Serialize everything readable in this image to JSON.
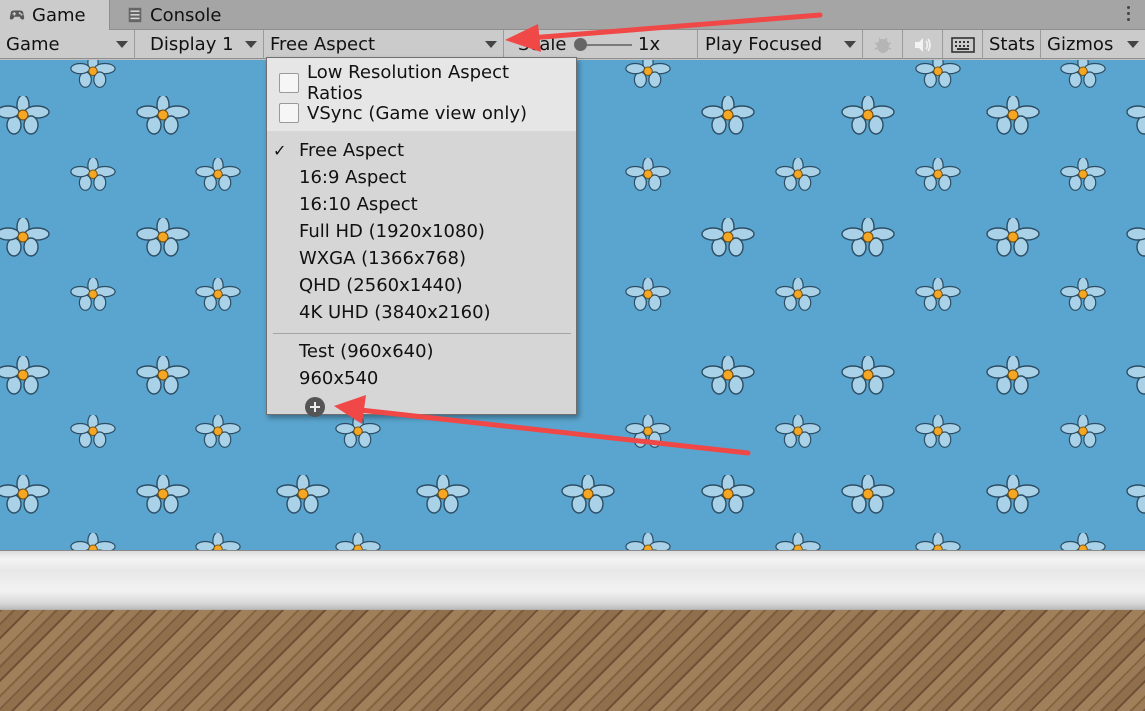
{
  "tabs": [
    {
      "label": "Game",
      "icon": "gamepad-icon"
    },
    {
      "label": "Console",
      "icon": "console-icon"
    }
  ],
  "toolbar": {
    "view_mode": "Game",
    "display": "Display 1",
    "aspect": "Free Aspect",
    "scale_label": "Scale",
    "scale_value": "1x",
    "play_mode": "Play Focused",
    "stats": "Stats",
    "gizmos": "Gizmos",
    "icons": [
      "bug-icon",
      "speaker-icon",
      "keyboard-icon"
    ]
  },
  "aspect_menu": {
    "options": [
      {
        "label": "Low Resolution Aspect Ratios",
        "checked": false
      },
      {
        "label": "VSync (Game view only)",
        "checked": false
      }
    ],
    "selected_mark": "✓",
    "builtin": [
      "Free Aspect",
      "16:9 Aspect",
      "16:10 Aspect",
      "Full HD (1920x1080)",
      "WXGA (1366x768)",
      "QHD (2560x1440)",
      "4K UHD (3840x2160)"
    ],
    "custom": [
      "Test (960x640)",
      "960x540"
    ],
    "selected": "Free Aspect"
  },
  "colors": {
    "annotation_arrow": "#f04747",
    "game_background": "#5aa5cf",
    "flower_petal": "#a9d2e9",
    "flower_center": "#f5a623"
  }
}
